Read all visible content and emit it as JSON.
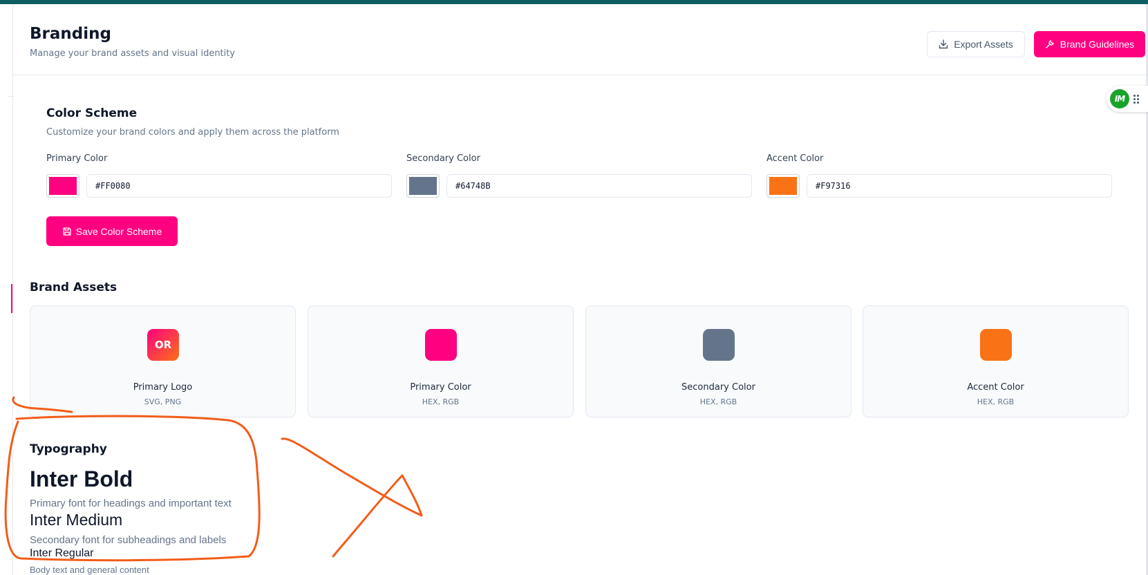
{
  "header": {
    "title": "Branding",
    "subtitle": "Manage your brand assets and visual identity",
    "export_label": "Export Assets",
    "guidelines_label": "Brand Guidelines"
  },
  "widget": {
    "avatar_text": "IM"
  },
  "color_scheme": {
    "title": "Color Scheme",
    "description": "Customize your brand colors and apply them across the platform",
    "fields": [
      {
        "label": "Primary Color",
        "value": "#FF0080",
        "swatch": "#FF0080"
      },
      {
        "label": "Secondary Color",
        "value": "#64748B",
        "swatch": "#64748B"
      },
      {
        "label": "Accent Color",
        "value": "#F97316",
        "swatch": "#F97316"
      }
    ],
    "save_label": "Save Color Scheme"
  },
  "brand_assets": {
    "title": "Brand Assets",
    "cards": [
      {
        "name": "Primary Logo",
        "formats": "SVG, PNG",
        "icon_text": "OR"
      },
      {
        "name": "Primary Color",
        "formats": "HEX, RGB",
        "icon_color": "#FF0080"
      },
      {
        "name": "Secondary Color",
        "formats": "HEX, RGB",
        "icon_color": "#64748B"
      },
      {
        "name": "Accent Color",
        "formats": "HEX, RGB",
        "icon_color": "#F97316"
      }
    ]
  },
  "typography": {
    "title": "Typography",
    "fonts": [
      {
        "name": "Inter Bold",
        "description": "Primary font for headings and important text"
      },
      {
        "name": "Inter Medium",
        "description": "Secondary font for subheadings and labels"
      },
      {
        "name": "Inter Regular",
        "description": "Body text and general content"
      }
    ]
  },
  "colors": {
    "brand": "#FF0080",
    "topbar": "#0F5E63",
    "annotation": "#F25C19"
  }
}
